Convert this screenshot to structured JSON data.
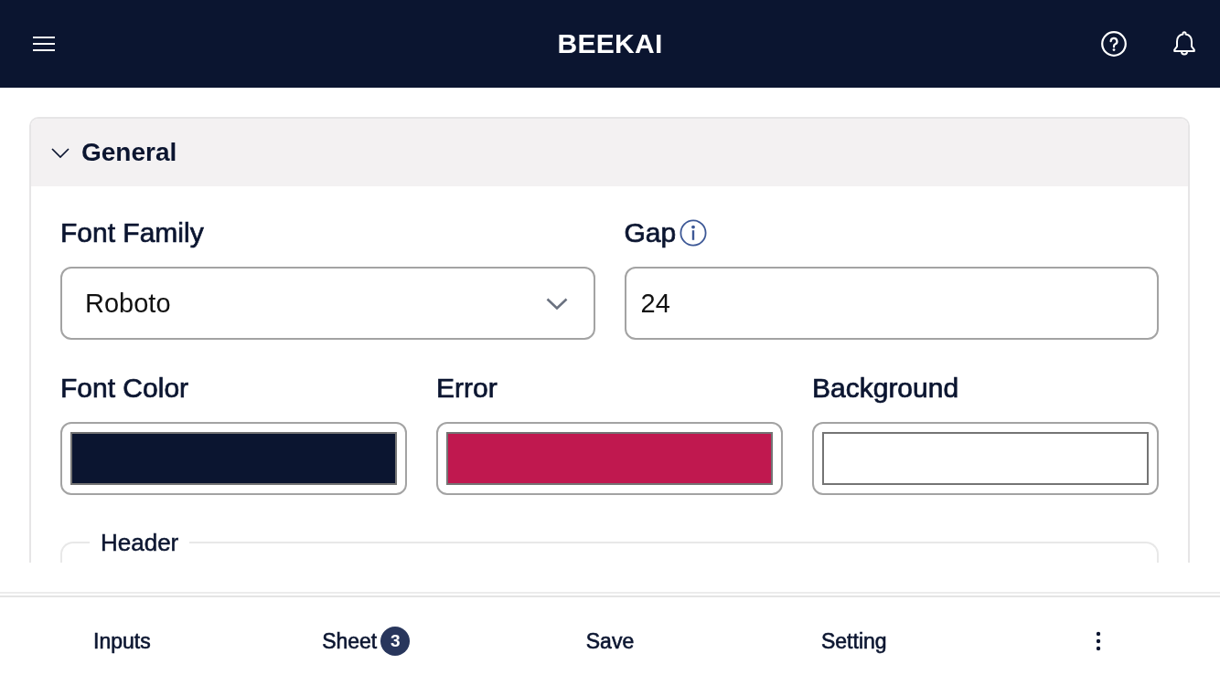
{
  "app_bar": {
    "title": "BEEKAI"
  },
  "section": {
    "title": "General",
    "expanded": true,
    "fields": [
      {
        "kind": "select",
        "label": "Font Family",
        "value": "Roboto"
      },
      {
        "kind": "text",
        "label": "Gap",
        "value": "24",
        "info": true
      }
    ],
    "color_fields": [
      {
        "label": "Font Color",
        "color": "#0b1530"
      },
      {
        "label": "Error",
        "color": "#c0184f"
      },
      {
        "label": "Background",
        "color": "#ffffff"
      }
    ],
    "groups": [
      {
        "legend": "Header"
      }
    ]
  },
  "bottom_nav": [
    {
      "kind": "label",
      "label": "Inputs"
    },
    {
      "kind": "label",
      "label": "Sheet",
      "badge": "3"
    },
    {
      "kind": "label",
      "label": "Save"
    },
    {
      "kind": "label",
      "label": "Setting"
    },
    {
      "kind": "more"
    }
  ]
}
